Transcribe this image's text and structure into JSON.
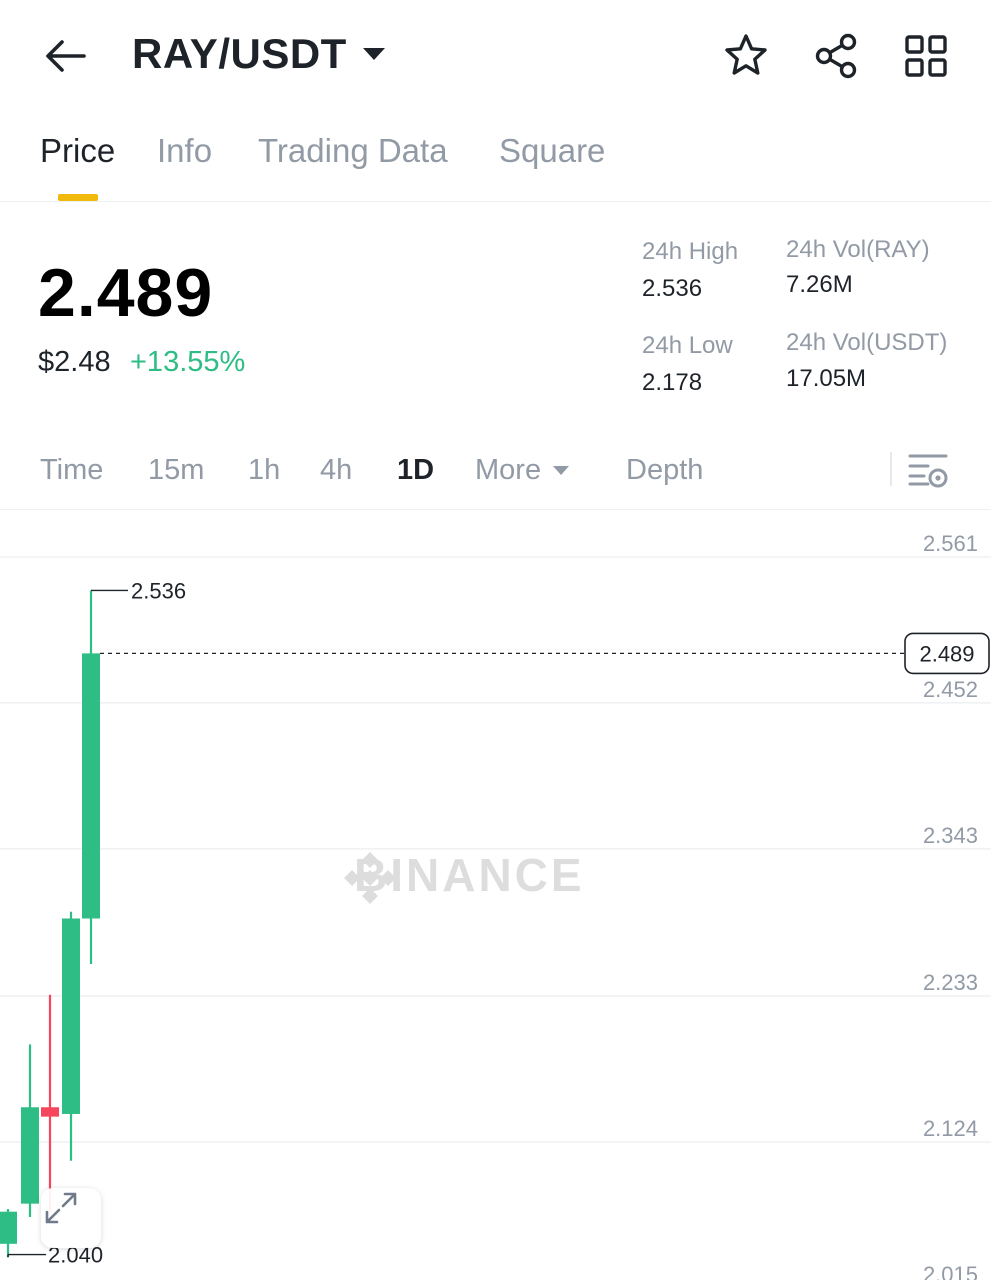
{
  "header": {
    "pair": "RAY/USDT",
    "icons": [
      "back-arrow-icon",
      "dropdown-caret-icon",
      "star-icon",
      "share-icon",
      "grid-icon"
    ]
  },
  "tabs": [
    "Price",
    "Info",
    "Trading Data",
    "Square"
  ],
  "price": {
    "last": "2.489",
    "usd": "$2.48",
    "change": "+13.55%",
    "change_color": "#2ebd85"
  },
  "stats": {
    "high_label": "24h High",
    "high_value": "2.536",
    "low_label": "24h Low",
    "low_value": "2.178",
    "vol_base_label": "24h Vol(RAY)",
    "vol_base_value": "7.26M",
    "vol_quote_label": "24h Vol(USDT)",
    "vol_quote_value": "17.05M"
  },
  "intervals": {
    "items": [
      "Time",
      "15m",
      "1h",
      "4h",
      "1D"
    ],
    "active": "1D",
    "more": "More",
    "depth": "Depth"
  },
  "chart_data": {
    "type": "candlestick",
    "y_ticks": [
      2.561,
      2.452,
      2.343,
      2.233,
      2.124,
      2.015
    ],
    "y_tick_labels": [
      "2.561",
      "2.452",
      "2.343",
      "2.233",
      "2.124",
      "2.015"
    ],
    "candles": [
      {
        "open": 2.048,
        "close": 2.072,
        "high": 2.074,
        "low": 2.038,
        "up": true
      },
      {
        "open": 2.078,
        "close": 2.15,
        "high": 2.197,
        "low": 2.068,
        "up": true
      },
      {
        "open": 2.15,
        "close": 2.143,
        "high": 2.234,
        "low": 2.072,
        "up": false
      },
      {
        "open": 2.145,
        "close": 2.291,
        "high": 2.296,
        "low": 2.11,
        "up": true
      },
      {
        "open": 2.291,
        "close": 2.489,
        "high": 2.536,
        "low": 2.257,
        "up": true
      }
    ],
    "max_label": "2.536",
    "min_label": "2.040",
    "current_price": 2.489,
    "current_label": "2.489",
    "watermark": "BINANCE",
    "up_color": "#2ebd85",
    "down_color": "#f6465d"
  }
}
